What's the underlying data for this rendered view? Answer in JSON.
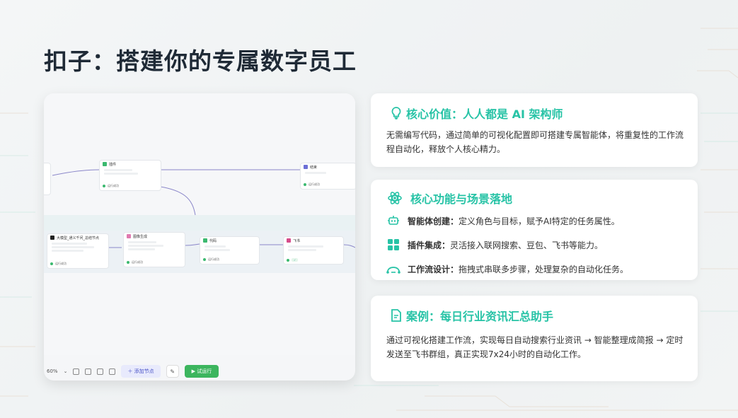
{
  "slide": {
    "title": "扣子：搭建你的专属数字员工"
  },
  "colors": {
    "accent": "#27c3a6",
    "title": "#1f2a36",
    "run_green": "#3cb55e"
  },
  "workflow": {
    "nodes": [
      {
        "label": "插件"
      },
      {
        "label": "结束"
      },
      {
        "label": "大模型_通义千问_总结节点"
      },
      {
        "label": "图像生成"
      },
      {
        "label": "代码"
      },
      {
        "label": "飞书"
      }
    ],
    "footer_tags": [
      "运行成功",
      "运行成功",
      "运行成功",
      "运行成功",
      "运行成功"
    ],
    "toolbar": {
      "zoom": "60%",
      "add_node_label": "添加节点",
      "run_label": "试运行"
    }
  },
  "cards": {
    "value": {
      "icon": "lightbulb-icon",
      "title": "核心价值：人人都是 AI 架构师",
      "body": "无需编写代码，通过简单的可视化配置即可搭建专属智能体，将重复性的工作流程自动化，释放个人核心精力。"
    },
    "features": {
      "icon": "atom-icon",
      "title": "核心功能与场景落地",
      "items": [
        {
          "icon": "robot-icon",
          "name": "智能体创建：",
          "desc": "定义角色与目标，赋予AI特定的任务属性。"
        },
        {
          "icon": "grid-icon",
          "name": "插件集成：",
          "desc": "灵活接入联网搜索、豆包、飞书等能力。"
        },
        {
          "icon": "flow-icon",
          "name": "工作流设计：",
          "desc": "拖拽式串联多步骤，处理复杂的自动化任务。"
        }
      ]
    },
    "case": {
      "icon": "document-icon",
      "title": "案例：每日行业资讯汇总助手",
      "body": "通过可视化搭建工作流，实现每日自动搜索行业资讯 → 智能整理成简报 → 定时发送至飞书群组，真正实现7x24小时的自动化工作。"
    }
  }
}
